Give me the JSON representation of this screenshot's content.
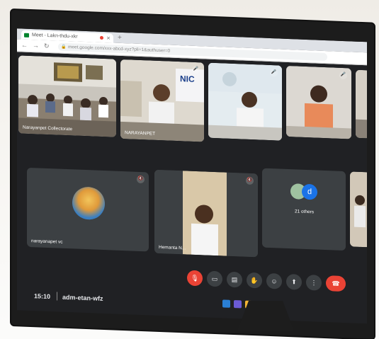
{
  "browser": {
    "tab_title": "Meet - Lakn-thdu-xkr",
    "url": "meet.google.com/xxx-abcd-xyz?pli=1&authuser=0"
  },
  "tiles": [
    {
      "name": "Narayanpet Collectorate"
    },
    {
      "name": "NARAYANPET"
    },
    {
      "name": ""
    },
    {
      "name": ""
    },
    {
      "name": ""
    },
    {
      "name": "narayanapet vc"
    },
    {
      "name": "Hemanta N..."
    },
    {
      "name": "21 others",
      "avatar_letter": "d"
    },
    {
      "name": ""
    }
  ],
  "footer": {
    "time": "15:10",
    "meeting_code": "adm-etan-wfz"
  },
  "colors": {
    "meet_bg": "#202124",
    "tile_bg": "#3c4043",
    "end_call": "#ea4335",
    "avatar_blue": "#1a73e8"
  },
  "icons": [
    "mic-off-icon",
    "camera-icon",
    "captions-icon",
    "raise-hand-icon",
    "emoji-icon",
    "present-icon",
    "more-icon",
    "end-call-icon"
  ]
}
